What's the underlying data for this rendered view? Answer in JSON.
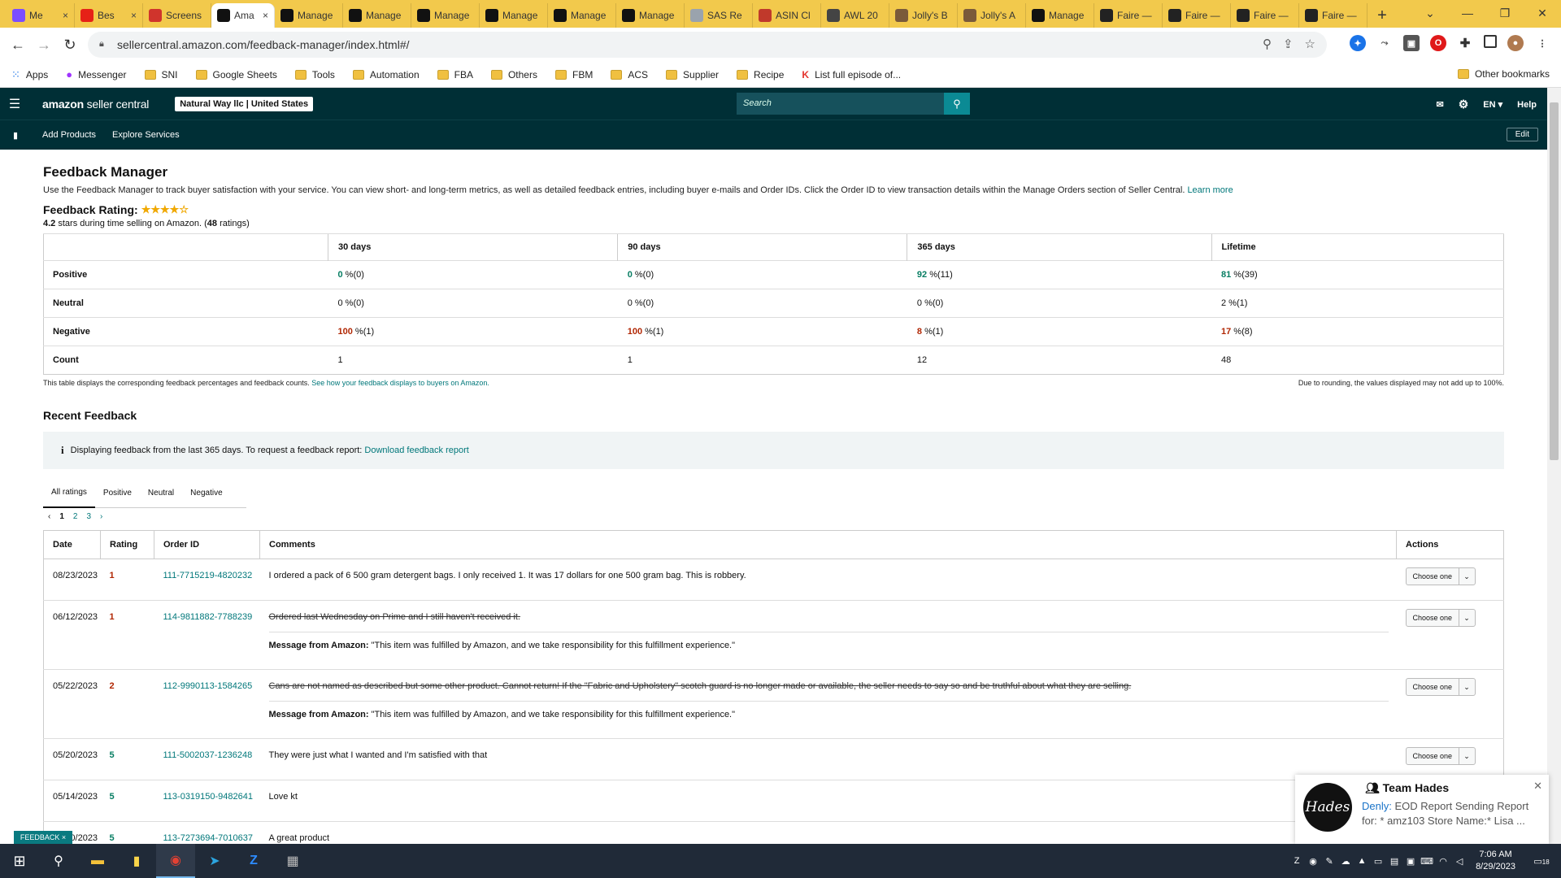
{
  "browser": {
    "tabs": [
      {
        "label": "Me",
        "icon": "messenger-icon",
        "color": "#7b4dff",
        "close": "×"
      },
      {
        "label": "Bes",
        "icon": "youtube-icon",
        "color": "#e62117",
        "close": "×"
      },
      {
        "label": "Screens",
        "icon": "screenshot-icon",
        "color": "#d0342c",
        "close": ""
      },
      {
        "label": "Ama",
        "icon": "amazon-icon",
        "color": "#111111",
        "close": "×",
        "active": true
      },
      {
        "label": "Manage",
        "icon": "amazon-icon",
        "color": "#111111",
        "close": ""
      },
      {
        "label": "Manage",
        "icon": "amazon-icon",
        "color": "#111111",
        "close": ""
      },
      {
        "label": "Manage",
        "icon": "amazon-icon",
        "color": "#111111",
        "close": ""
      },
      {
        "label": "Manage",
        "icon": "amazon-icon",
        "color": "#111111",
        "close": ""
      },
      {
        "label": "Manage",
        "icon": "amazon-icon",
        "color": "#111111",
        "close": ""
      },
      {
        "label": "Manage",
        "icon": "amazon-icon",
        "color": "#111111",
        "close": ""
      },
      {
        "label": "SAS Re",
        "icon": "sas-icon",
        "color": "#9aa3ad",
        "close": ""
      },
      {
        "label": "ASIN Cl",
        "icon": "asin-icon",
        "color": "#c0392b",
        "close": ""
      },
      {
        "label": "AWL 20",
        "icon": "awl-icon",
        "color": "#444444",
        "close": ""
      },
      {
        "label": "Jolly's B",
        "icon": "jolly-icon",
        "color": "#7a5a3a",
        "close": ""
      },
      {
        "label": "Jolly's A",
        "icon": "jolly-icon",
        "color": "#7a5a3a",
        "close": ""
      },
      {
        "label": "Manage",
        "icon": "amazon-icon",
        "color": "#111111",
        "close": ""
      },
      {
        "label": "Faire —",
        "icon": "faire-icon",
        "color": "#222222",
        "close": ""
      },
      {
        "label": "Faire —",
        "icon": "faire-icon",
        "color": "#222222",
        "close": ""
      },
      {
        "label": "Faire —",
        "icon": "faire-icon",
        "color": "#222222",
        "close": ""
      },
      {
        "label": "Faire —",
        "icon": "faire-icon",
        "color": "#222222",
        "close": ""
      }
    ],
    "new_tab": "+",
    "url": "sellercentral.amazon.com/feedback-manager/index.html#/",
    "bookmarks": [
      {
        "label": "Apps",
        "type": "apps"
      },
      {
        "label": "Messenger",
        "type": "messenger"
      },
      {
        "label": "SNI",
        "type": "folder"
      },
      {
        "label": "Google Sheets",
        "type": "folder"
      },
      {
        "label": "Tools",
        "type": "folder"
      },
      {
        "label": "Automation",
        "type": "folder"
      },
      {
        "label": "FBA",
        "type": "folder"
      },
      {
        "label": "Others",
        "type": "folder"
      },
      {
        "label": "FBM",
        "type": "folder"
      },
      {
        "label": "ACS",
        "type": "folder"
      },
      {
        "label": "Supplier",
        "type": "folder"
      },
      {
        "label": "Recipe",
        "type": "folder"
      },
      {
        "label": "List full episode of...",
        "type": "k"
      }
    ],
    "other_bookmarks": "Other bookmarks"
  },
  "sc": {
    "logo_bold": "amazon",
    "logo_rest": " seller central",
    "account": "Natural Way llc | United States",
    "search_placeholder": "Search",
    "lang": "EN",
    "help": "Help",
    "sub_links": [
      "Add Products",
      "Explore Services"
    ],
    "edit": "Edit"
  },
  "page": {
    "title": "Feedback Manager",
    "description": "Use the Feedback Manager to track buyer satisfaction with your service. You can view short- and long-term metrics, as well as detailed feedback entries, including buyer e-mails and Order IDs. Click the Order ID to view transaction details within the Manage Orders section of Seller Central.",
    "learn_more": "Learn more",
    "rating_label": "Feedback Rating:",
    "stars": "★★★★☆",
    "rating_value": "4.2",
    "rating_sub_mid": " stars during time selling on Amazon. (",
    "rating_count": "48",
    "rating_sub_end": " ratings)",
    "columns": [
      "30 days",
      "90 days",
      "365 days",
      "Lifetime"
    ],
    "rows": [
      {
        "label": "Positive",
        "style": "green",
        "cells": [
          [
            "0",
            " %(0)"
          ],
          [
            "0",
            " %(0)"
          ],
          [
            "92",
            " %(11)"
          ],
          [
            "81",
            " %(39)"
          ]
        ]
      },
      {
        "label": "Neutral",
        "style": "plain",
        "cells": [
          [
            "0",
            " %(0)"
          ],
          [
            "0",
            " %(0)"
          ],
          [
            "0",
            " %(0)"
          ],
          [
            "2",
            " %(1)"
          ]
        ]
      },
      {
        "label": "Negative",
        "style": "red",
        "cells": [
          [
            "100",
            " %(1)"
          ],
          [
            "100",
            " %(1)"
          ],
          [
            "8",
            " %(1)"
          ],
          [
            "17",
            " %(8)"
          ]
        ]
      },
      {
        "label": "Count",
        "style": "plain",
        "cells": [
          [
            "1",
            ""
          ],
          [
            "1",
            ""
          ],
          [
            "12",
            ""
          ],
          [
            "48",
            ""
          ]
        ]
      }
    ],
    "table_note": "This table displays the corresponding feedback percentages and feedback counts.",
    "table_note_link": "See how your feedback displays to buyers on Amazon.",
    "rounding_note": "Due to rounding, the values displayed may not add up to 100%.",
    "recent_title": "Recent Feedback",
    "info_text": "Displaying feedback from the last 365 days. To request a feedback report:",
    "info_link": "Download feedback report",
    "filter_tabs": [
      "All ratings",
      "Positive",
      "Neutral",
      "Negative"
    ],
    "pager": {
      "prev": "‹",
      "pages": [
        "1",
        "2",
        "3"
      ],
      "next": "›"
    },
    "feedback_headers": [
      "Date",
      "Rating",
      "Order ID",
      "Comments",
      "Actions"
    ],
    "feedback": [
      {
        "date": "08/23/2023",
        "rating": "1",
        "order": "111-7715219-4820232",
        "comment": "I ordered a pack of 6 500 gram detergent bags. I only received 1. It was 17 dollars for one 500 gram bag. This is robbery.",
        "struck": false,
        "message": ""
      },
      {
        "date": "06/12/2023",
        "rating": "1",
        "order": "114-9811882-7788239",
        "comment": "Ordered last Wednesday on Prime and I still haven't received it.",
        "struck": true,
        "message": "\"This item was fulfilled by Amazon, and we take responsibility for this fulfillment experience.\""
      },
      {
        "date": "05/22/2023",
        "rating": "2",
        "order": "112-9990113-1584265",
        "comment": "Cans are not named as described but some other product. Cannot return! If the \"Fabric and Upholstery\" scotch guard is no longer made or available, the seller needs to say so and be truthful about what they are selling.",
        "struck": true,
        "message": "\"This item was fulfilled by Amazon, and we take responsibility for this fulfillment experience.\""
      },
      {
        "date": "05/20/2023",
        "rating": "5",
        "order": "111-5002037-1236248",
        "comment": "They were just what I wanted and I'm satisfied with that",
        "struck": false,
        "message": ""
      },
      {
        "date": "05/14/2023",
        "rating": "5",
        "order": "113-0319150-9482641",
        "comment": "Love kt",
        "struck": false,
        "message": ""
      },
      {
        "date": "05/10/2023",
        "rating": "5",
        "order": "113-7273694-7010637",
        "comment": "A great product",
        "struck": false,
        "message": ""
      }
    ],
    "message_prefix": "Message from Amazon:",
    "choose_label": "Choose one"
  },
  "notification": {
    "title": "Team Hades",
    "avatar_text": "Hades",
    "sender": "Denly:",
    "body": " EOD Report Sending Report for: * amz103  Store Name:* Lisa ..."
  },
  "feedback_tab": "FEEDBACK ×",
  "taskbar": {
    "time": "7:06 AM",
    "date": "8/29/2023",
    "badge": "18"
  }
}
